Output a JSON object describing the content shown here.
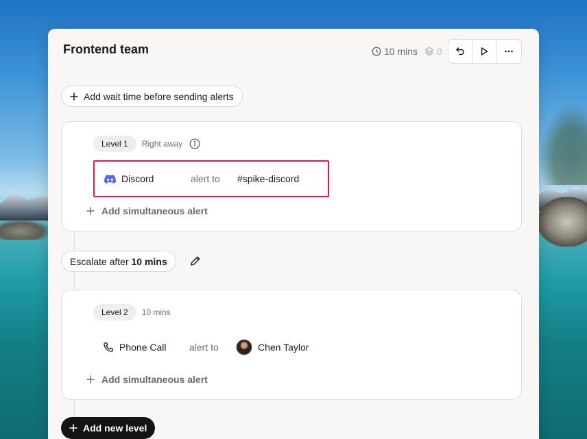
{
  "header": {
    "title": "Frontend team",
    "duration": "10 mins",
    "layers_count": "0"
  },
  "toolbar": {
    "undo_icon": "undo-icon",
    "play_icon": "play-icon",
    "more_icon": "more-icon"
  },
  "wait_time": {
    "label": "Add wait time before sending alerts"
  },
  "levels": [
    {
      "tag": "Level 1",
      "timing": "Right away",
      "alert": {
        "channel": "Discord",
        "connector": "alert to",
        "target": "#spike-discord"
      },
      "add_label": "Add simultaneous alert"
    },
    {
      "tag": "Level 2",
      "timing": "10 mins",
      "alert": {
        "channel": "Phone Call",
        "connector": "alert to",
        "target": "Chen Taylor"
      },
      "add_label": "Add simultaneous alert"
    }
  ],
  "escalate": {
    "prefix": "Escalate after",
    "value": "10 mins"
  },
  "add_level": {
    "label": "Add new level"
  },
  "colors": {
    "highlight": "#e0174e",
    "discord": "#5865f2",
    "panel_bg": "#f8f7f5",
    "dark_button": "#141414"
  }
}
